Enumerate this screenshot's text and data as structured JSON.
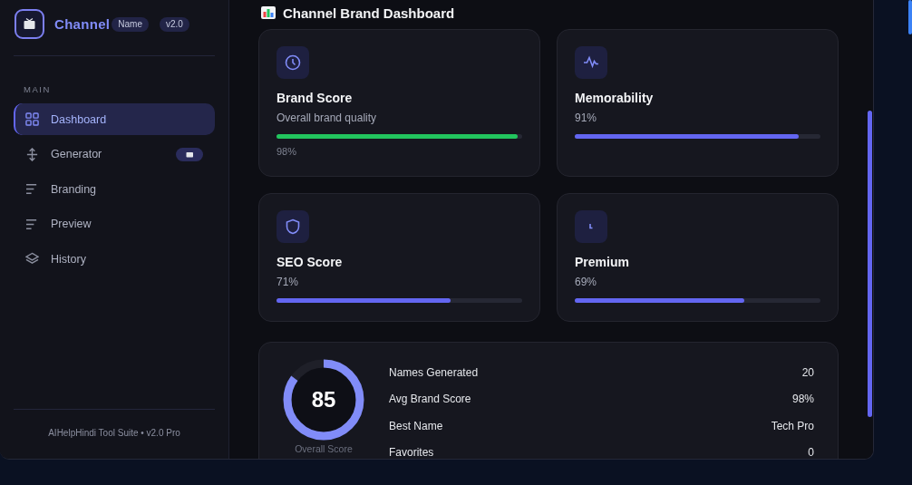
{
  "sidebar": {
    "brand": {
      "title": "Channel",
      "tag": "Name",
      "version": "v2.0"
    },
    "section_label": "MAIN",
    "items": [
      {
        "label": "Dashboard",
        "selected": true,
        "badge": false
      },
      {
        "label": "Generator",
        "selected": false,
        "badge": true
      },
      {
        "label": "Branding",
        "selected": false,
        "badge": false
      },
      {
        "label": "Preview",
        "selected": false,
        "badge": false
      },
      {
        "label": "History",
        "selected": false,
        "badge": false
      }
    ],
    "footer": "AIHelpHindi Tool Suite • v2.0 Pro"
  },
  "main": {
    "heading": "Channel Brand Dashboard",
    "cards": [
      {
        "kind": "detailed",
        "title": "Brand Score",
        "description": "Overall brand quality",
        "value": "98%",
        "level": 0.98,
        "color": "#22c55e"
      },
      {
        "kind": "simple",
        "title": "Memorability",
        "value": "91%",
        "level": 0.91,
        "color": "#6366f1"
      },
      {
        "kind": "simple",
        "title": "SEO Score",
        "value": "71%",
        "level": 0.71,
        "color": "#6366f1"
      },
      {
        "kind": "simple",
        "title": "Premium",
        "value": "69%",
        "level": 0.69,
        "color": "#6366f1"
      }
    ],
    "summary": {
      "score": "85",
      "level": 0.85,
      "label": "Overall Score",
      "stats": [
        {
          "label": "Names Generated",
          "value": "20"
        },
        {
          "label": "Avg Brand Score",
          "value": "98%"
        },
        {
          "label": "Best Name",
          "value": "Tech Pro"
        },
        {
          "label": "Favorites",
          "value": "0"
        }
      ]
    }
  }
}
